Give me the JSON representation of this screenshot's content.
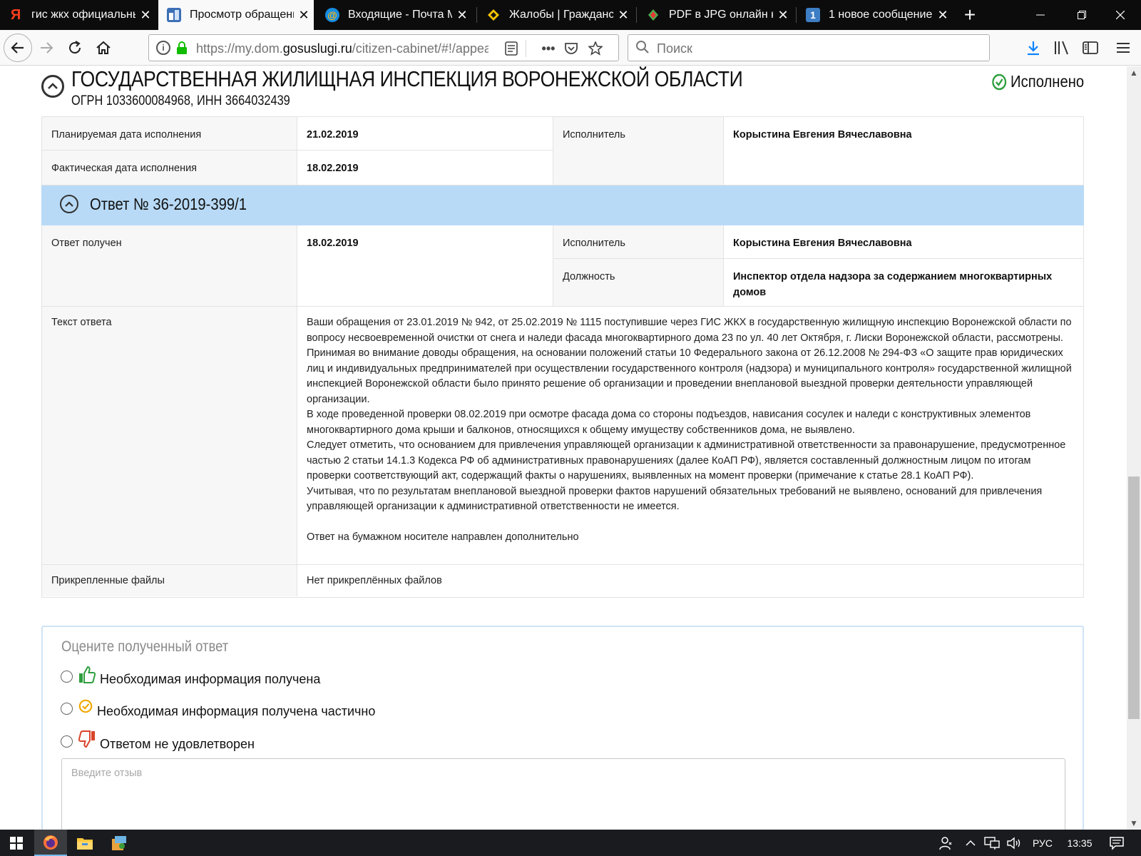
{
  "browser": {
    "tabs": [
      {
        "title": "гис жкх официальный",
        "favicon": "yandex-icon",
        "active": false
      },
      {
        "title": "Просмотр обращения",
        "favicon": "gosuslugi-icon",
        "active": true
      },
      {
        "title": "Входящие - Почта Mail.Ru",
        "favicon": "mail-ru-icon",
        "active": false
      },
      {
        "title": "Жалобы | Гражданский",
        "favicon": "complaints-icon",
        "active": false
      },
      {
        "title": "PDF в JPG онлайн конвертер",
        "favicon": "pdf-icon",
        "active": false
      },
      {
        "title": "1 новое сообщение",
        "favicon": "message-icon",
        "active": false
      }
    ],
    "url_prefix": "https://my.dom.",
    "url_domain": "gosuslugi.ru",
    "url_suffix": "/citizen-cabinet/#!/appeal",
    "search_placeholder": "Поиск"
  },
  "org": {
    "name": "ГОСУДАРСТВЕННАЯ ЖИЛИЩНАЯ ИНСПЕКЦИЯ ВОРОНЕЖСКОЙ ОБЛАСТИ",
    "ids": "ОГРН 1033600084968, ИНН 3664032439",
    "status": "Исполнено"
  },
  "execution": {
    "planned_label": "Планируемая дата исполнения",
    "planned_value": "21.02.2019",
    "actual_label": "Фактическая дата исполнения",
    "actual_value": "18.02.2019",
    "executor_label": "Исполнитель",
    "executor_value": "Корыстина Евгения Вячеславовна"
  },
  "answer": {
    "title": "Ответ № 36-2019-399/1",
    "received_label": "Ответ получен",
    "received_value": "18.02.2019",
    "executor_label": "Исполнитель",
    "executor_value": "Корыстина Евгения Вячеславовна",
    "position_label": "Должность",
    "position_value": "Инспектор отдела надзора за содержанием многоквартирных домов",
    "text_label": "Текст ответа",
    "text_paragraphs": [
      "Ваши обращения от 23.01.2019 № 942, от 25.02.2019 № 1115 поступившие через ГИС ЖКХ в государственную жилищную инспекцию Воронежской области по вопросу несвоевременной очистки от снега и наледи фасада многоквартирного дома 23 по ул. 40 лет Октября, г. Лиски Воронежской области, рассмотрены.",
      "Принимая во внимание доводы обращения, на основании положений статьи 10 Федерального закона от 26.12.2008 № 294-ФЗ «О защите прав юридических лиц и индивидуальных предпринимателей при осуществлении государственного контроля (надзора) и муниципального контроля» государственной жилищной инспекцией Воронежской области было принято решение об организации и проведении внеплановой выездной проверки деятельности управляющей организации.",
      "В ходе проведенной проверки 08.02.2019 при осмотре  фасада дома со стороны подъездов, нависания сосулек и наледи с конструктивных элементов многоквартирного дома крыши и балконов, относящихся к общему имуществу собственников дома,  не выявлено.",
      "Следует отметить, что основанием для привлечения управляющей организации к административной ответственности за правонарушение, предусмотренное частью 2 статьи 14.1.3 Кодекса РФ об административных правонарушениях (далее КоАП РФ), является составленный должностным лицом по итогам проверки соответствующий акт, содержащий факты о нарушениях, выявленных на момент проверки (примечание к статье 28.1 КоАП РФ).",
      "Учитывая, что по результатам внеплановой выездной проверки фактов нарушений обязательных требований не выявлено, оснований для привлечения управляющей организации к административной ответственности не имеется.",
      "",
      "Ответ на бумажном носителе направлен дополнительно"
    ],
    "files_label": "Прикрепленные файлы",
    "files_value": "Нет прикреплённых файлов"
  },
  "rating": {
    "title": "Оцените полученный ответ",
    "options": [
      {
        "label": "Необходимая информация получена",
        "icon": "thumbs-up-icon",
        "color": "#2e9e3e"
      },
      {
        "label": "Необходимая информация получена частично",
        "icon": "partial-check-icon",
        "color": "#f0a800"
      },
      {
        "label": "Ответом не удовлетворен",
        "icon": "thumbs-down-icon",
        "color": "#d9442b"
      }
    ],
    "review_placeholder": "Введите отзыв"
  },
  "taskbar": {
    "language": "РУС",
    "time": "13:35"
  },
  "colors": {
    "answer_header_bg": "#b8daf6",
    "status_ok": "#2e9e3e",
    "label_cell_bg": "#f7f7f7"
  }
}
